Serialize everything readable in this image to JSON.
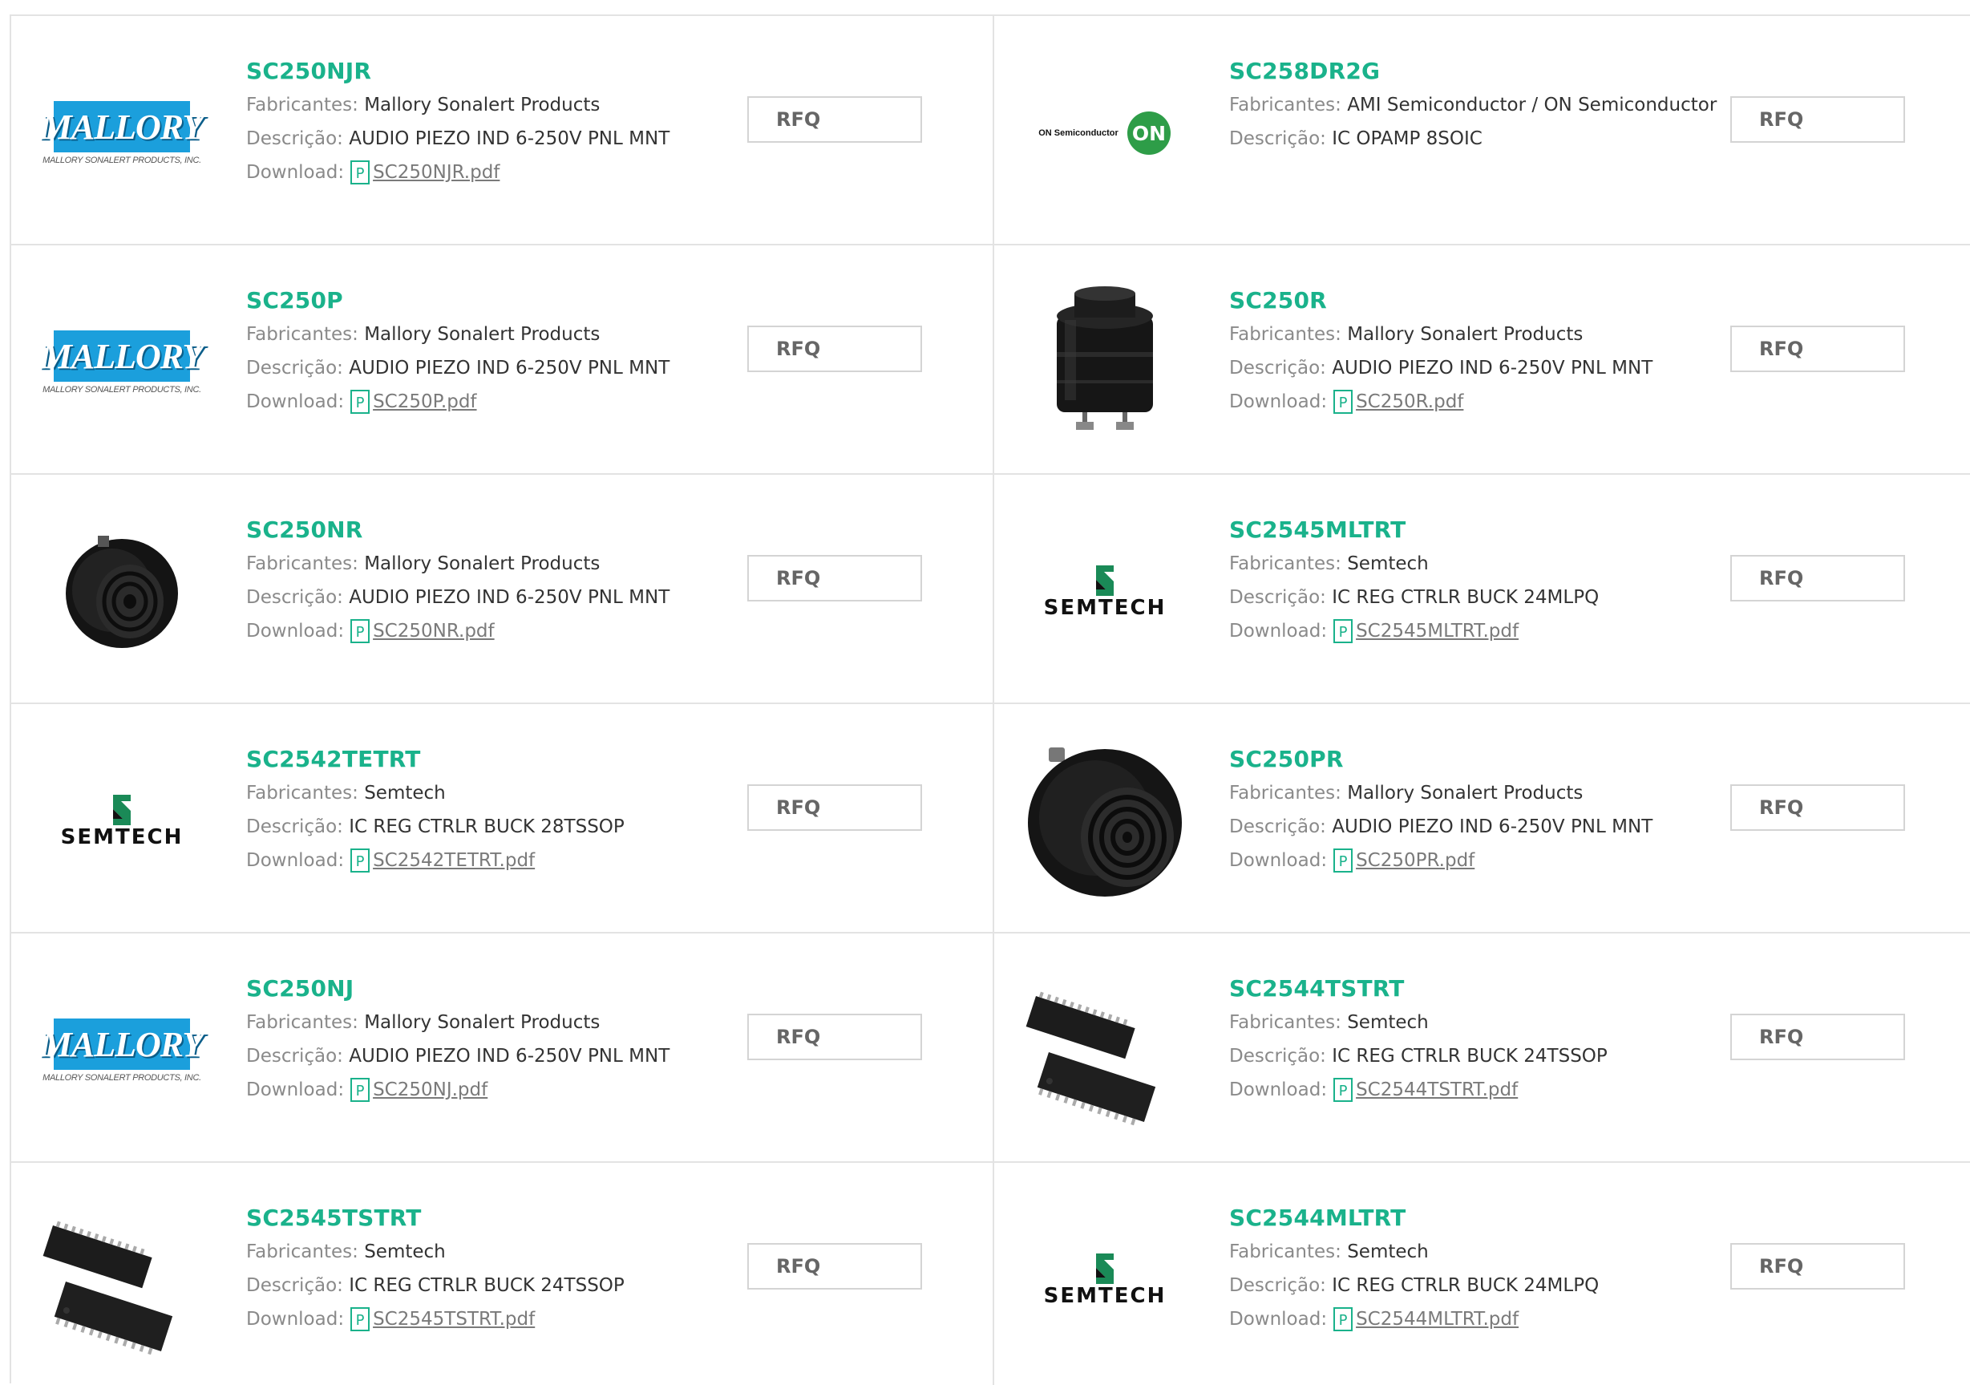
{
  "labels": {
    "manufacturer": "Fabricantes:",
    "description": "Descrição:",
    "download": "Download:",
    "rfq": "RFQ"
  },
  "logos": {
    "mallory_name": "MALLORY",
    "mallory_sub": "MALLORY SONALERT PRODUCTS, INC.",
    "semtech_name": "SEMTECH",
    "on_text": "ON Semiconductor",
    "on_badge": "ON"
  },
  "colors": {
    "part_link": "#1ab28b",
    "mallory_blue": "#1b9fdc",
    "on_green": "#2e9d48"
  },
  "products": [
    {
      "part": "SC250NJR",
      "manufacturer": "Mallory Sonalert Products",
      "description": "AUDIO PIEZO IND 6-250V PNL MNT",
      "download": "SC250NJR.pdf",
      "image": "mallory-logo"
    },
    {
      "part": "SC258DR2G",
      "manufacturer": "AMI Semiconductor / ON Semiconductor",
      "description": "IC OPAMP 8SOIC",
      "download": "",
      "image": "on-semiconductor-logo"
    },
    {
      "part": "SC250P",
      "manufacturer": "Mallory Sonalert Products",
      "description": "AUDIO PIEZO IND 6-250V PNL MNT",
      "download": "SC250P.pdf",
      "image": "mallory-logo"
    },
    {
      "part": "SC250R",
      "manufacturer": "Mallory Sonalert Products",
      "description": "AUDIO PIEZO IND 6-250V PNL MNT",
      "download": "SC250R.pdf",
      "image": "buzzer-cylinder"
    },
    {
      "part": "SC250NR",
      "manufacturer": "Mallory Sonalert Products",
      "description": "AUDIO PIEZO IND 6-250V PNL MNT",
      "download": "SC250NR.pdf",
      "image": "buzzer-round"
    },
    {
      "part": "SC2545MLTRT",
      "manufacturer": "Semtech",
      "description": "IC REG CTRLR BUCK 24MLPQ",
      "download": "SC2545MLTRT.pdf",
      "image": "semtech-logo"
    },
    {
      "part": "SC2542TETRT",
      "manufacturer": "Semtech",
      "description": "IC REG CTRLR BUCK 28TSSOP",
      "download": "SC2542TETRT.pdf",
      "image": "semtech-logo"
    },
    {
      "part": "SC250PR",
      "manufacturer": "Mallory Sonalert Products",
      "description": "AUDIO PIEZO IND 6-250V PNL MNT",
      "download": "SC250PR.pdf",
      "image": "buzzer-round"
    },
    {
      "part": "SC250NJ",
      "manufacturer": "Mallory Sonalert Products",
      "description": "AUDIO PIEZO IND 6-250V PNL MNT",
      "download": "SC250NJ.pdf",
      "image": "mallory-logo"
    },
    {
      "part": "SC2544TSTRT",
      "manufacturer": "Semtech",
      "description": "IC REG CTRLR BUCK 24TSSOP",
      "download": "SC2544TSTRT.pdf",
      "image": "tssop-chips"
    },
    {
      "part": "SC2545TSTRT",
      "manufacturer": "Semtech",
      "description": "IC REG CTRLR BUCK 24TSSOP",
      "download": "SC2545TSTRT.pdf",
      "image": "tssop-chips"
    },
    {
      "part": "SC2544MLTRT",
      "manufacturer": "Semtech",
      "description": "IC REG CTRLR BUCK 24MLPQ",
      "download": "SC2544MLTRT.pdf",
      "image": "semtech-logo"
    }
  ]
}
